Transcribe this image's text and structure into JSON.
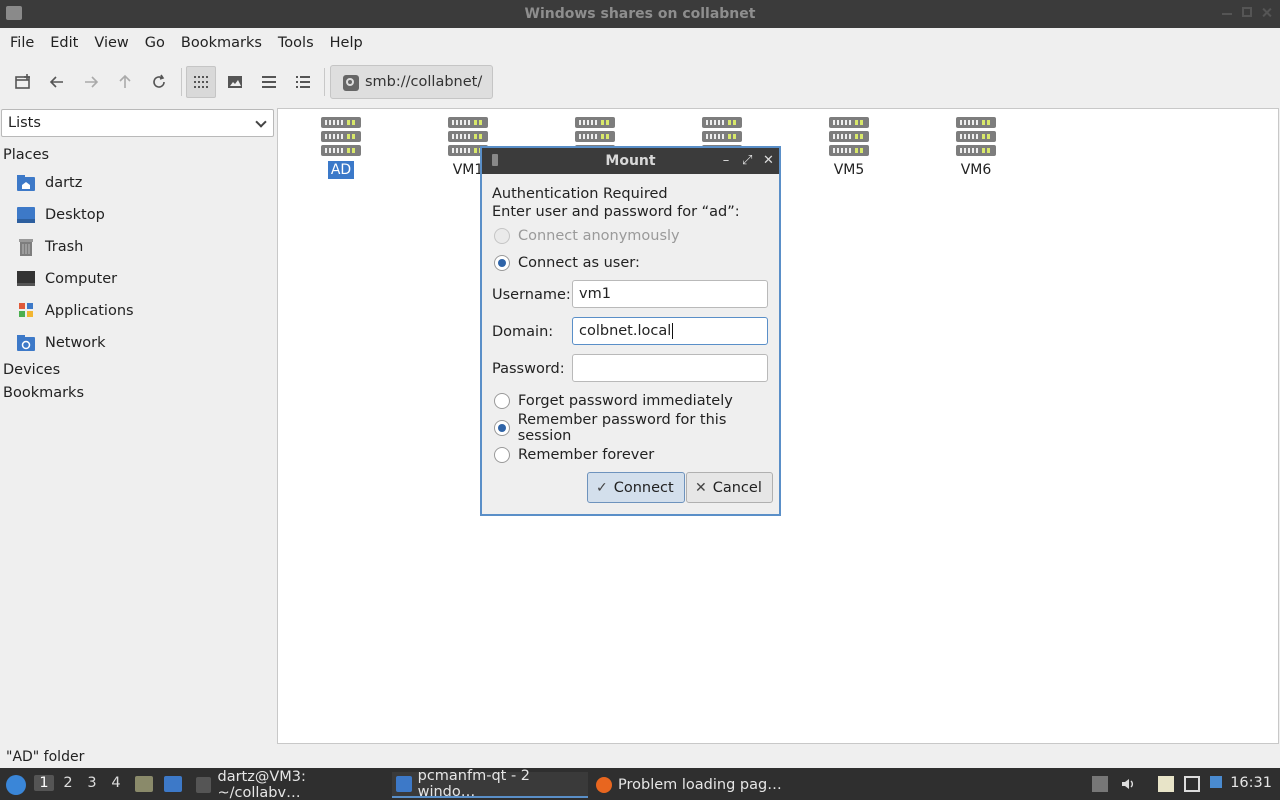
{
  "window": {
    "title": "Windows shares on collabnet"
  },
  "menubar": {
    "items": [
      "File",
      "Edit",
      "View",
      "Go",
      "Bookmarks",
      "Tools",
      "Help"
    ]
  },
  "toolbar": {
    "path": "smb://collabnet/"
  },
  "sidebar": {
    "selector": "Lists",
    "places_header": "Places",
    "places": [
      "dartz",
      "Desktop",
      "Trash",
      "Computer",
      "Applications",
      "Network"
    ],
    "devices_header": "Devices",
    "bookmarks_header": "Bookmarks"
  },
  "main": {
    "items": [
      "AD",
      "VM1",
      "",
      "",
      "VM5",
      "VM6"
    ],
    "selected": "AD"
  },
  "status": {
    "text": "\"AD\" folder"
  },
  "dialog": {
    "title": "Mount",
    "heading": "Authentication Required",
    "prompt": "Enter user and password for “ad”:",
    "anon_label": "Connect anonymously",
    "user_label": "Connect as user:",
    "username_label": "Username:",
    "username_value": "vm1",
    "domain_label": "Domain:",
    "domain_value": "colbnet.local",
    "password_label": "Password:",
    "password_value": "",
    "forget_label": "Forget password immediately",
    "session_label": "Remember password for this session",
    "forever_label": "Remember forever",
    "connect_label": "Connect",
    "cancel_label": "Cancel"
  },
  "taskbar": {
    "workspaces": [
      "1",
      "2",
      "3",
      "4"
    ],
    "tasks": [
      "dartz@VM3: ~/collabv…",
      "pcmanfm-qt - 2 windo…",
      "Problem loading pag…"
    ],
    "clock": "16:31"
  },
  "colors": {
    "accent": "#3b79c9",
    "titlebar": "#3b3b3b",
    "taskbar": "#2f2f2f"
  }
}
